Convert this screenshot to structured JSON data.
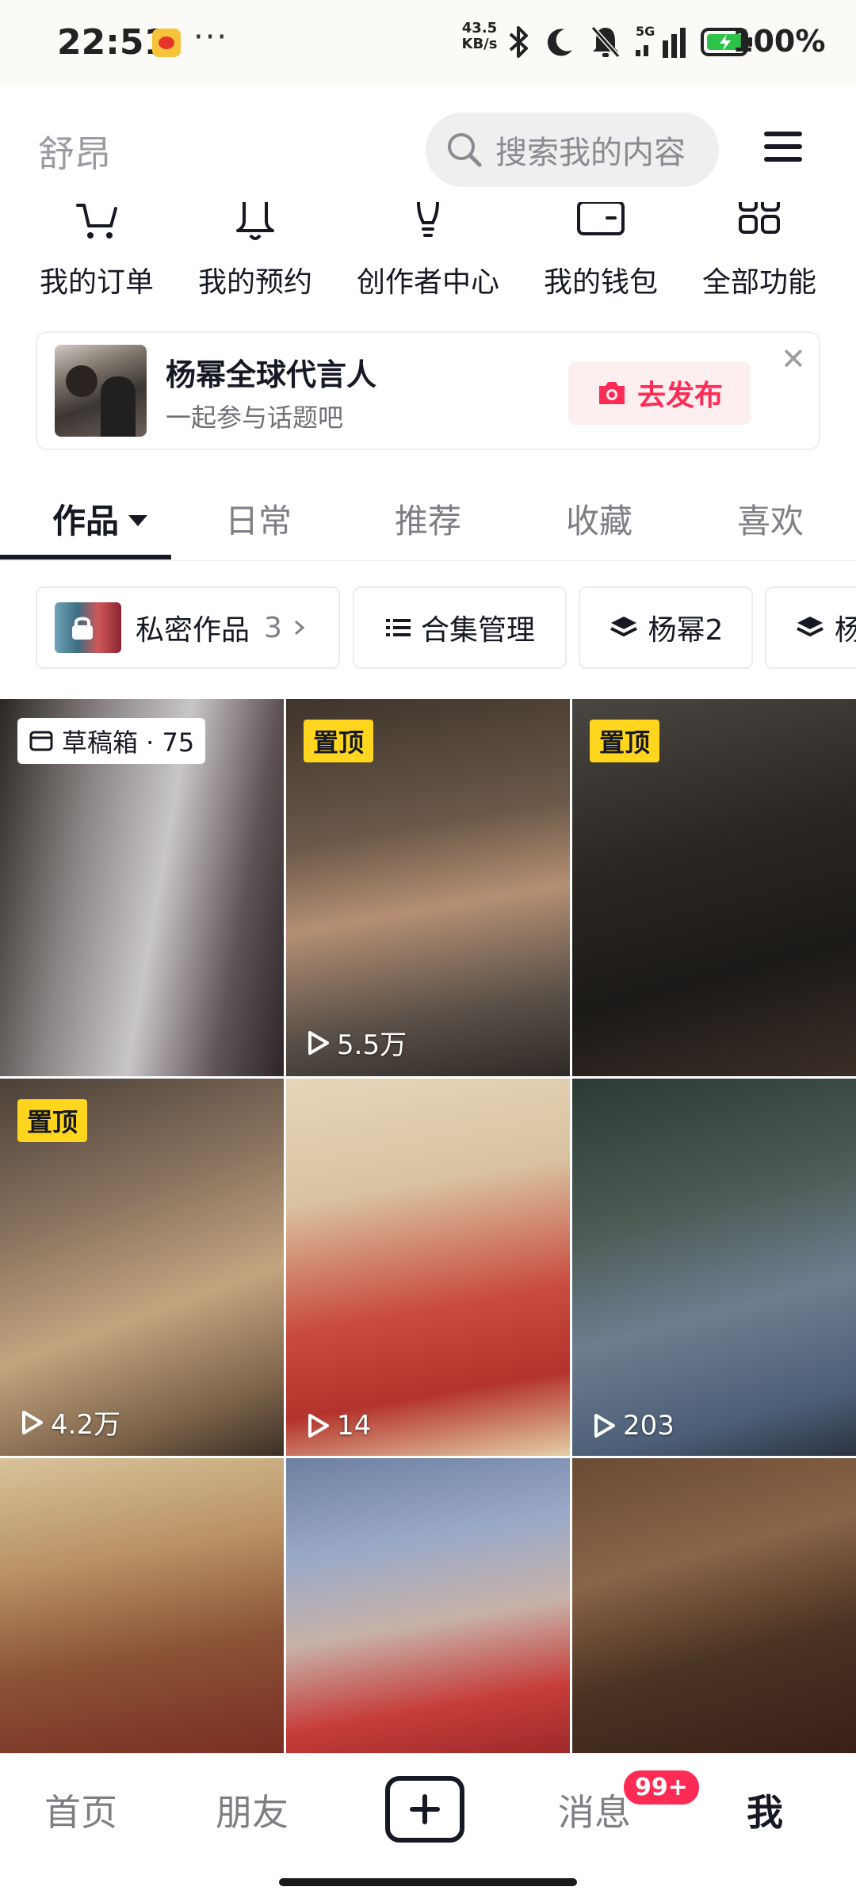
{
  "status_bar": {
    "time": "22:51",
    "net_speed_value": "43.5",
    "net_speed_unit": "KB/s",
    "network": "5G",
    "battery": "100%",
    "icons": [
      "weibo-app-icon",
      "more-dots-icon",
      "bluetooth-icon",
      "moon-icon",
      "mute-bell-icon",
      "signal-icon",
      "battery-charging-icon"
    ]
  },
  "header": {
    "name": "舒昂",
    "search_placeholder": "搜索我的内容"
  },
  "shortcuts": [
    {
      "label": "我的订单",
      "icon": "cart-icon"
    },
    {
      "label": "我的预约",
      "icon": "bell-icon"
    },
    {
      "label": "创作者中心",
      "icon": "bulb-icon"
    },
    {
      "label": "我的钱包",
      "icon": "wallet-icon"
    },
    {
      "label": "全部功能",
      "icon": "grid-apps-icon"
    }
  ],
  "promo": {
    "title": "杨幂全球代言人",
    "subtitle": "一起参与话题吧",
    "button": "去发布"
  },
  "tabs": [
    {
      "label": "作品",
      "active": true
    },
    {
      "label": "日常"
    },
    {
      "label": "推荐"
    },
    {
      "label": "收藏"
    },
    {
      "label": "喜欢"
    }
  ],
  "chips": [
    {
      "label": "私密作品",
      "count": "3"
    },
    {
      "label": "合集管理"
    },
    {
      "label": "杨幂2"
    },
    {
      "label": "杨"
    }
  ],
  "grid": [
    {
      "badge": "草稿箱 · 75",
      "badge_type": "draft",
      "plays": ""
    },
    {
      "badge": "置顶",
      "badge_type": "pinned",
      "plays": "5.5万"
    },
    {
      "badge": "置顶",
      "badge_type": "pinned",
      "plays": ""
    },
    {
      "badge": "置顶",
      "badge_type": "pinned",
      "plays": "4.2万"
    },
    {
      "badge": "",
      "plays": "14"
    },
    {
      "badge": "",
      "plays": "203"
    },
    {
      "badge": "",
      "plays": ""
    },
    {
      "badge": "",
      "plays": ""
    },
    {
      "badge": "",
      "plays": ""
    }
  ],
  "bottom_nav": {
    "home": "首页",
    "friends": "朋友",
    "messages": "消息",
    "messages_badge": "99+",
    "me": "我"
  },
  "colors": {
    "accent": "#fe2c55",
    "pinned_badge": "#ffd61d",
    "text_primary": "#161823",
    "text_secondary": "#7e7f84"
  }
}
